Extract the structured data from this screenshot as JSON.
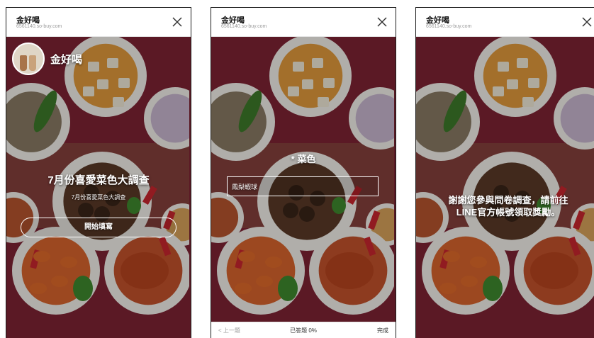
{
  "header": {
    "title": "金好喝",
    "url": "6561140.so-buy.com"
  },
  "welcome": {
    "brand_name": "金好喝",
    "survey_title": "7月份喜愛菜色大調查",
    "survey_subtitle": "7月份喜愛菜色大調查",
    "start_button": "開始填寫"
  },
  "question": {
    "label": "* 菜色",
    "answer_value": "鳳梨蝦球",
    "nav": {
      "prev_label": "< 上一題",
      "progress_label": "已答題 0%",
      "done_label": "完成"
    }
  },
  "thanks": {
    "line1": "謝謝您參與問卷調查，請前往",
    "line2": "LINE官方帳號領取獎勵。"
  },
  "icons": {
    "close": "close-icon"
  },
  "colors": {
    "background_red": "#7e2334",
    "header_bg": "#ffffff",
    "text_on_photo": "#ffffff"
  }
}
